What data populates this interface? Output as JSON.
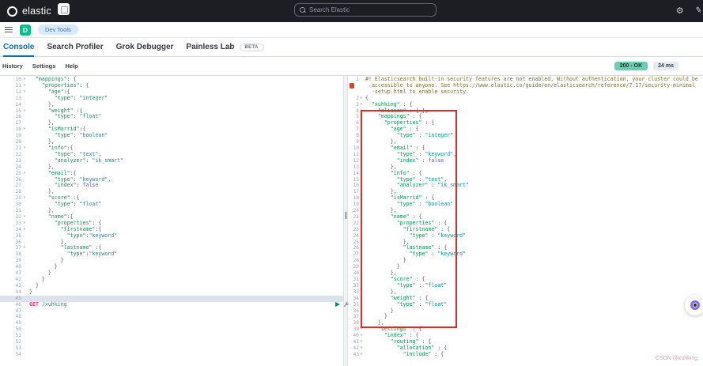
{
  "header": {
    "brand": "elastic",
    "search_placeholder": "Search Elastic"
  },
  "nav": {
    "space_initial": "D",
    "breadcrumb": "Dev Tools"
  },
  "tabs": [
    {
      "label": "Console",
      "active": true
    },
    {
      "label": "Search Profiler",
      "active": false
    },
    {
      "label": "Grok Debugger",
      "active": false
    },
    {
      "label": "Painless Lab",
      "active": false,
      "badge": "BETA"
    }
  ],
  "toolbar": {
    "menu": [
      "History",
      "Settings",
      "Help"
    ],
    "status_badge": "200 - OK",
    "time_badge": "24 ms"
  },
  "request_editor": {
    "lines": [
      {
        "n": 10,
        "t": [
          "k:  \"mappings\"",
          "p:: {"
        ]
      },
      {
        "n": 11,
        "t": [
          "k:    \"properties\"",
          "p:: {"
        ]
      },
      {
        "n": 12,
        "t": [
          "k:      \"age\"",
          "p::{"
        ]
      },
      {
        "n": 13,
        "t": [
          "k:        \"type\"",
          "p:: ",
          "v:\"integer\""
        ]
      },
      {
        "n": 14,
        "t": [
          "p:      },"
        ]
      },
      {
        "n": 15,
        "t": [
          "k:      \"weight\"",
          "p: :{"
        ]
      },
      {
        "n": 16,
        "t": [
          "k:        \"type\"",
          "p:: ",
          "v:\"float\""
        ]
      },
      {
        "n": 17,
        "t": [
          "p:      },"
        ]
      },
      {
        "n": 18,
        "t": [
          "k:      \"isMarrid\"",
          "p::{"
        ]
      },
      {
        "n": 19,
        "t": [
          "k:        \"type\"",
          "p:: ",
          "v:\"boolean\""
        ]
      },
      {
        "n": 20,
        "t": [
          "p:      },"
        ]
      },
      {
        "n": 21,
        "t": [
          "k:      \"info\"",
          "p::{"
        ]
      },
      {
        "n": 22,
        "t": [
          "k:        \"type\"",
          "p:: ",
          "v:\"text\"",
          "p:,"
        ]
      },
      {
        "n": 23,
        "t": [
          "k:        \"analyzer\"",
          "p:: ",
          "v:\"ik_smart\""
        ]
      },
      {
        "n": 24,
        "t": [
          "p:      },"
        ]
      },
      {
        "n": 25,
        "t": [
          "k:      \"email\"",
          "p::{"
        ]
      },
      {
        "n": 26,
        "t": [
          "k:        \"type\"",
          "p:: ",
          "v:\"keyword\"",
          "p:,"
        ]
      },
      {
        "n": 27,
        "t": [
          "k:        \"index\"",
          "p:: ",
          "b:false"
        ]
      },
      {
        "n": 28,
        "t": [
          "p:      },"
        ]
      },
      {
        "n": 29,
        "t": [
          "k:      \"score\"",
          "p: :{"
        ]
      },
      {
        "n": 30,
        "t": [
          "k:        \"type\"",
          "p:: ",
          "v:\"float\""
        ]
      },
      {
        "n": 31,
        "t": [
          "p:      },"
        ]
      },
      {
        "n": 32,
        "t": [
          "k:      \"name\"",
          "p::{"
        ]
      },
      {
        "n": 33,
        "t": [
          "k:        \"properties\"",
          "p:: {"
        ]
      },
      {
        "n": 34,
        "t": [
          "k:          \"firstname\"",
          "p::{"
        ]
      },
      {
        "n": 35,
        "t": [
          "k:            \"type\"",
          "p::",
          "v:\"keyword\""
        ]
      },
      {
        "n": 36,
        "t": [
          "p:          },"
        ]
      },
      {
        "n": 37,
        "t": [
          "k:          \"lastname\"",
          "p: :{"
        ]
      },
      {
        "n": 38,
        "t": [
          "k:            \"type\"",
          "p::",
          "v:\"keyword\""
        ]
      },
      {
        "n": 39,
        "t": [
          "p:          }"
        ]
      },
      {
        "n": 40,
        "t": [
          "p:        }"
        ]
      },
      {
        "n": 41,
        "t": [
          "p:      }"
        ]
      },
      {
        "n": 42,
        "t": [
          "p:    }"
        ]
      },
      {
        "n": 43,
        "t": [
          "p:  }"
        ]
      },
      {
        "n": 44,
        "t": [
          "p:}"
        ]
      },
      {
        "n": 45,
        "t": [],
        "active": true
      },
      {
        "n": 46,
        "t": [
          "m:GET ",
          "u:/xuhking"
        ]
      },
      {
        "n": 47,
        "t": []
      },
      {
        "n": 48,
        "t": []
      },
      {
        "n": 49,
        "t": []
      },
      {
        "n": 50,
        "t": []
      },
      {
        "n": 51,
        "t": []
      },
      {
        "n": 52,
        "t": []
      },
      {
        "n": 53,
        "t": []
      },
      {
        "n": 54,
        "t": []
      }
    ]
  },
  "response_viewer": {
    "warning_rows": [
      "#! Elasticsearch built-in security features are not enabled. Without authentication, your cluster could be",
      "  accessible to anyone. See https://www.elastic.co/guide/en/elasticsearch/reference/7.17/security-minimal",
      "  -setup.html to enable security."
    ],
    "lines": [
      {
        "n": 2,
        "t": [
          "p:{"
        ]
      },
      {
        "n": 3,
        "t": [
          "k:  \"xuhking\"",
          "p: : {"
        ]
      },
      {
        "n": 4,
        "t": [
          "k:    \"aliases\"",
          "p: : { },"
        ]
      },
      {
        "n": 5,
        "t": [
          "k:    \"mappings\"",
          "p: : {"
        ]
      },
      {
        "n": 6,
        "t": [
          "k:      \"properties\"",
          "p: : {"
        ]
      },
      {
        "n": 7,
        "t": [
          "k:        \"age\"",
          "p: : {"
        ]
      },
      {
        "n": 8,
        "t": [
          "k:          \"type\"",
          "p: : ",
          "v:\"integer\""
        ]
      },
      {
        "n": 9,
        "t": [
          "p:        },"
        ]
      },
      {
        "n": 10,
        "t": [
          "k:        \"email\"",
          "p: : {"
        ]
      },
      {
        "n": 11,
        "t": [
          "k:          \"type\"",
          "p: : ",
          "v:\"keyword\"",
          "p:,"
        ]
      },
      {
        "n": 12,
        "t": [
          "k:          \"index\"",
          "p: : ",
          "b:false"
        ]
      },
      {
        "n": 13,
        "t": [
          "p:        },"
        ]
      },
      {
        "n": 14,
        "t": [
          "k:        \"info\"",
          "p: : {"
        ]
      },
      {
        "n": 15,
        "t": [
          "k:          \"type\"",
          "p: : ",
          "v:\"text\"",
          "p:,"
        ]
      },
      {
        "n": 16,
        "t": [
          "k:          \"analyzer\"",
          "p: : ",
          "v:\"ik_smart\""
        ]
      },
      {
        "n": 17,
        "t": [
          "p:        },"
        ]
      },
      {
        "n": 18,
        "t": [
          "k:        \"isMarrid\"",
          "p: : {"
        ]
      },
      {
        "n": 19,
        "t": [
          "k:          \"type\"",
          "p: : ",
          "v:\"boolean\""
        ]
      },
      {
        "n": 20,
        "t": [
          "p:        },"
        ]
      },
      {
        "n": 21,
        "t": [
          "k:        \"name\"",
          "p: : {"
        ]
      },
      {
        "n": 22,
        "t": [
          "k:          \"properties\"",
          "p: : {"
        ]
      },
      {
        "n": 23,
        "t": [
          "k:            \"firstname\"",
          "p: : {"
        ]
      },
      {
        "n": 24,
        "t": [
          "k:              \"type\"",
          "p: : ",
          "v:\"keyword\""
        ]
      },
      {
        "n": 25,
        "t": [
          "p:            },"
        ]
      },
      {
        "n": 26,
        "t": [
          "k:            \"lastname\"",
          "p: : {"
        ]
      },
      {
        "n": 27,
        "t": [
          "k:              \"type\"",
          "p: : ",
          "v:\"keyword\""
        ]
      },
      {
        "n": 28,
        "t": [
          "p:            }"
        ]
      },
      {
        "n": 29,
        "t": [
          "p:          }"
        ]
      },
      {
        "n": 30,
        "t": [
          "p:        },"
        ]
      },
      {
        "n": 31,
        "t": [
          "k:        \"score\"",
          "p: : {"
        ]
      },
      {
        "n": 32,
        "t": [
          "k:          \"type\"",
          "p: : ",
          "v:\"float\""
        ]
      },
      {
        "n": 33,
        "t": [
          "p:        },"
        ]
      },
      {
        "n": 34,
        "t": [
          "k:        \"weight\"",
          "p: : {"
        ]
      },
      {
        "n": 35,
        "t": [
          "k:          \"type\"",
          "p: : ",
          "v:\"float\""
        ]
      },
      {
        "n": 36,
        "t": [
          "p:        }"
        ]
      },
      {
        "n": 37,
        "t": [
          "p:      }"
        ]
      },
      {
        "n": 38,
        "t": [
          "p:    },"
        ]
      },
      {
        "n": 39,
        "t": [
          "k:    \"settings\"",
          "p: : {"
        ]
      },
      {
        "n": 40,
        "t": [
          "k:      \"index\"",
          "p: : {"
        ]
      },
      {
        "n": 41,
        "t": [
          "k:        \"routing\"",
          "p: : {"
        ]
      },
      {
        "n": 42,
        "t": [
          "k:          \"allocation\"",
          "p: : {"
        ]
      },
      {
        "n": 43,
        "t": [
          "k:            \"include\"",
          "p: : {"
        ]
      }
    ]
  },
  "watermark": "CSDN @xuhking",
  "colors": {
    "accent": "#0871b8",
    "badgegreen": "#6dccb1",
    "space_badge": "#00c08b",
    "crumb_bg": "#d8e9f9",
    "crumb_text": "#2e7cc0",
    "key": "#0e9456",
    "str": "#0e90a7",
    "punct": "#586072",
    "const": "#6158c9",
    "method": "#d13a83",
    "url": "#0c9a7a",
    "warn": "#7f6e2f",
    "red": "#e02a2a",
    "play": "#0b8a54"
  }
}
